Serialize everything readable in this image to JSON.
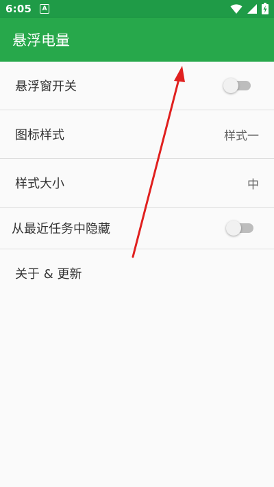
{
  "status_bar": {
    "time": "6:05",
    "notification_glyph": "A",
    "icons": [
      "wifi-icon",
      "signal-icon",
      "battery-charging-icon"
    ]
  },
  "app_bar": {
    "title": "悬浮电量",
    "color": "#27a84b"
  },
  "settings": {
    "floating_window": {
      "label": "悬浮窗开关",
      "enabled": false
    },
    "icon_style": {
      "label": "图标样式",
      "value": "样式一"
    },
    "style_size": {
      "label": "样式大小",
      "value": "中"
    },
    "hide_from_recents": {
      "label": "从最近任务中隐藏",
      "enabled": false
    },
    "about": {
      "label": "关于 & 更新"
    }
  },
  "annotation": {
    "arrow_color": "#e0201f"
  }
}
